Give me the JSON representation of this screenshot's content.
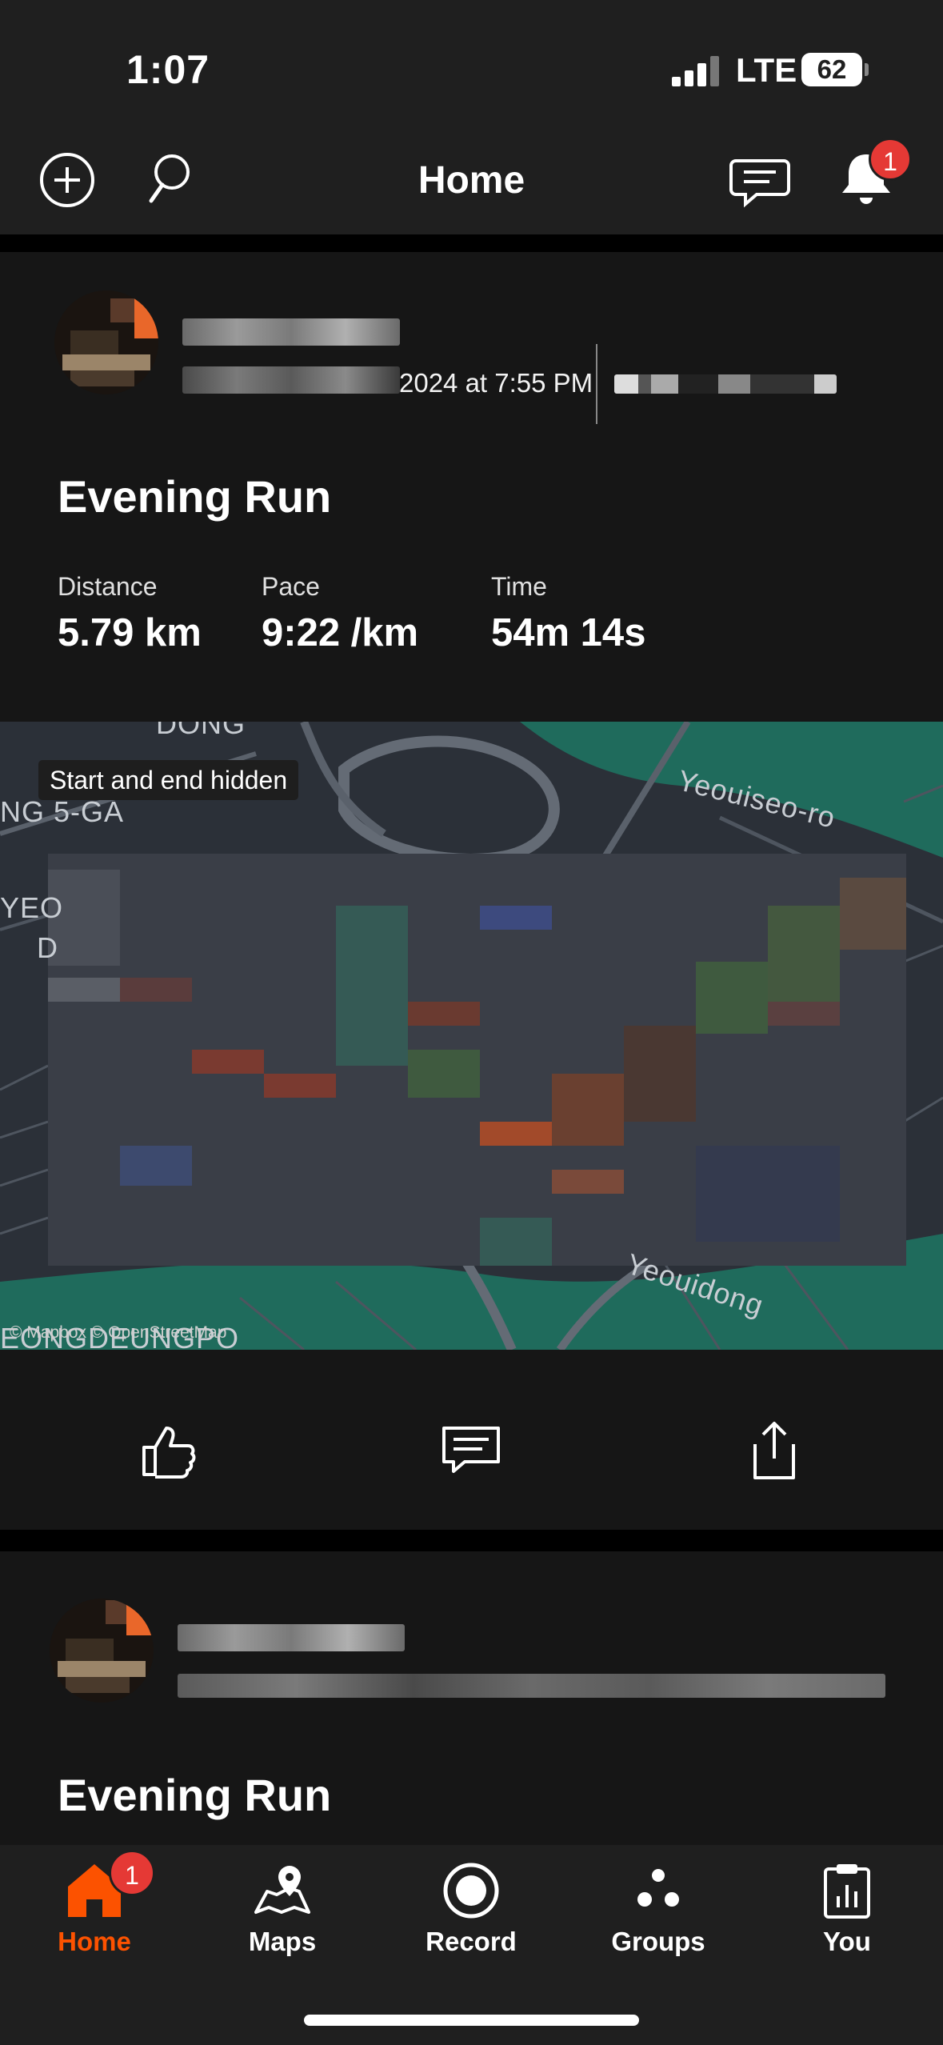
{
  "status_bar": {
    "time": "1:07",
    "network": "LTE",
    "battery": "62"
  },
  "header": {
    "title": "Home",
    "notification_count": "1",
    "icons": [
      "add-circle-icon",
      "search-icon",
      "chat-icon",
      "bell-icon"
    ]
  },
  "feed": [
    {
      "date_partial": "2024 at 7:55 PM",
      "title": "Evening Run",
      "stats": [
        {
          "label": "Distance",
          "value": "5.79 km"
        },
        {
          "label": "Pace",
          "value": "9:22 /km"
        },
        {
          "label": "Time",
          "value": "54m 14s"
        }
      ],
      "map": {
        "badge": "Start and end hidden",
        "labels": [
          "DONG",
          "NG 5-GA",
          "YEO",
          "D",
          "Yeouiseo-ro",
          "Yeouidong",
          "EONGDEUNGPO"
        ],
        "attribution": "© Mapbox © OpenStreetMap"
      },
      "actions": [
        "thumbs-up-icon",
        "comment-icon",
        "share-icon"
      ]
    },
    {
      "title": "Evening Run"
    }
  ],
  "tab_bar": {
    "tabs": [
      {
        "label": "Home",
        "icon": "home-icon",
        "active": true
      },
      {
        "label": "Maps",
        "icon": "map-pin-icon",
        "active": false
      },
      {
        "label": "Record",
        "icon": "record-icon",
        "active": false
      },
      {
        "label": "Groups",
        "icon": "groups-icon",
        "active": false
      },
      {
        "label": "You",
        "icon": "clipboard-icon",
        "active": false
      }
    ],
    "home_badge": "1"
  },
  "colors": {
    "accent": "#fc5200",
    "badge": "#e53935",
    "background": "#121212",
    "map_water": "#1f6b5c"
  }
}
